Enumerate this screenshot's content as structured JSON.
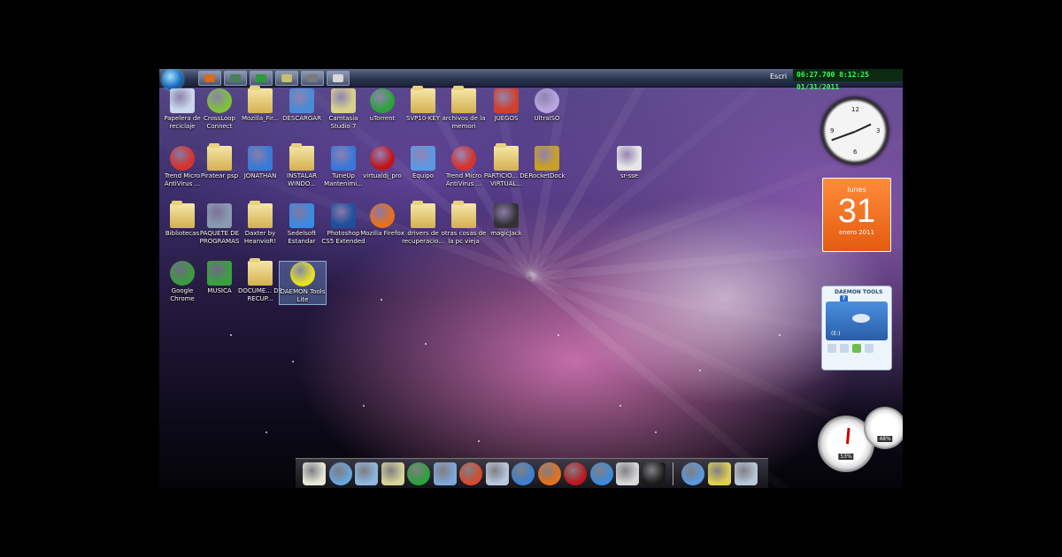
{
  "taskbar": {
    "tray_label": "Escri",
    "clock_text": "06:27.700 8:12:25  01/31/2011",
    "buttons": [
      {
        "name": "media-player",
        "color": "#d86b1c"
      },
      {
        "name": "network",
        "color": "#4a7f5a"
      },
      {
        "name": "utorrent",
        "color": "#2a9a3a"
      },
      {
        "name": "note",
        "color": "#c8c070"
      },
      {
        "name": "tools",
        "color": "#7a7a7a"
      },
      {
        "name": "window",
        "color": "#d8d8d8"
      }
    ]
  },
  "desktop_icons": [
    {
      "label": "Papelera de reciclaje",
      "icon": "recycle-bin-icon",
      "color": "#c9d8ec"
    },
    {
      "label": "CrossLoop Connect",
      "icon": "crossloop-icon",
      "color": "#7fc23a"
    },
    {
      "label": "Mozilla_Fir...",
      "icon": "folder-icon",
      "color": "#e8cf79"
    },
    {
      "label": "DESCARGAR",
      "icon": "computer-icon",
      "color": "#4a8bd6"
    },
    {
      "label": "Camtasia Studio 7",
      "icon": "camtasia-icon",
      "color": "#d7d18a"
    },
    {
      "label": "uTorrent",
      "icon": "utorrent-icon",
      "color": "#2aa33a"
    },
    {
      "label": "SVP10-KEY",
      "icon": "folder-icon",
      "color": "#e8cf79"
    },
    {
      "label": "archivos de la memori",
      "icon": "folder-icon",
      "color": "#e8cf79"
    },
    {
      "label": "JUEGOS",
      "icon": "games-icon",
      "color": "#d0402a"
    },
    {
      "label": "UltraISO",
      "icon": "disc-icon",
      "color": "#b9a6e0"
    },
    {
      "label": "Trend Micro AntiVirus ...",
      "icon": "trend-micro-icon",
      "color": "#d8322a"
    },
    {
      "label": "Piratear psp",
      "icon": "folder-icon",
      "color": "#e8cf79"
    },
    {
      "label": "JONATHAN",
      "icon": "monitor-icon",
      "color": "#3a7ad6"
    },
    {
      "label": "INSTALAR WINDO...",
      "icon": "folder-icon",
      "color": "#e8cf79"
    },
    {
      "label": "TuneUp Mantenimi...",
      "icon": "tuneup-icon",
      "color": "#3a78d8"
    },
    {
      "label": "virtualdj_pro",
      "icon": "virtualdj-icon",
      "color": "#c0141c"
    },
    {
      "label": "Equipo",
      "icon": "computer-icon",
      "color": "#5a9ae0"
    },
    {
      "label": "Trend Micro AntiVirus ...",
      "icon": "trend-micro-icon",
      "color": "#d8322a"
    },
    {
      "label": "PARTICIO... DE VIRTUAL...",
      "icon": "folder-icon",
      "color": "#e8cf79"
    },
    {
      "label": "RocketDock",
      "icon": "rocketdock-icon",
      "color": "#c9a020"
    },
    {
      "label": "Bibliotecas",
      "icon": "libraries-icon",
      "color": "#e8cf79"
    },
    {
      "label": "PAQUETE DE PROGRAMAS",
      "icon": "installer-icon",
      "color": "#8a9ab0"
    },
    {
      "label": "Daxter by HeanvioR!",
      "icon": "folder-icon",
      "color": "#e8cf79"
    },
    {
      "label": "Sedelsoft Estandar",
      "icon": "chat-icon",
      "color": "#3a8be0"
    },
    {
      "label": "Photoshop CS5 Extended",
      "icon": "photoshop-icon",
      "color": "#1f4f9a"
    },
    {
      "label": "Mozilla Firefox",
      "icon": "firefox-icon",
      "color": "#e8701a"
    },
    {
      "label": "drivers de recuperacio...",
      "icon": "folder-icon",
      "color": "#e8cf79"
    },
    {
      "label": "otras cosas de la pc vieja",
      "icon": "folder-icon",
      "color": "#e8cf79"
    },
    {
      "label": "magicJack",
      "icon": "magicjack-icon",
      "color": "#333333"
    },
    {
      "label": "Google Chrome",
      "icon": "chrome-icon",
      "color": "#3b9b3f"
    },
    {
      "label": "MUSICA",
      "icon": "music-arrow-icon",
      "color": "#3aa040"
    },
    {
      "label": "DOCUME... DE RECUP...",
      "icon": "folder-icon",
      "color": "#e8cf79"
    },
    {
      "label": "DAEMON Tools Lite",
      "icon": "daemon-tools-icon",
      "color": "#e8e020"
    },
    {
      "label": "sr-sse",
      "icon": "file-icon",
      "color": "#e6e6e6"
    }
  ],
  "gadgets": {
    "clock": {
      "numbers": [
        "12",
        "3",
        "6",
        "9"
      ]
    },
    "calendar": {
      "weekday": "lunes",
      "day": "31",
      "month_year": "enero 2011"
    },
    "daemon": {
      "title": "DAEMON TOOLS",
      "help": "?",
      "drive": "(E:)"
    },
    "cpu_meter": {
      "value": "53%"
    },
    "ram_meter": {
      "value": "48%"
    }
  },
  "dock": {
    "items": [
      {
        "name": "notes-dock-icon",
        "color": "#e8e8d8"
      },
      {
        "name": "globe-dock-icon",
        "color": "#6aa6de"
      },
      {
        "name": "folder-dock-icon",
        "color": "#8fb7e0"
      },
      {
        "name": "note-dock-icon",
        "color": "#d8d49a"
      },
      {
        "name": "utorrent-dock-icon",
        "color": "#2aa33a"
      },
      {
        "name": "files-dock-icon",
        "color": "#7fa8d8"
      },
      {
        "name": "chrome-dock-icon",
        "color": "#d84a2a"
      },
      {
        "name": "documents-dock-icon",
        "color": "#b8c8dc"
      },
      {
        "name": "ie-dock-icon",
        "color": "#3a80d6"
      },
      {
        "name": "firefox-dock-icon",
        "color": "#e8701a"
      },
      {
        "name": "virtualdj-dock-icon",
        "color": "#c0141c"
      },
      {
        "name": "messenger-dock-icon",
        "color": "#3a8be0"
      },
      {
        "name": "tools-dock-icon",
        "color": "#d8d8d8"
      },
      {
        "name": "shirt-dock-icon",
        "color": "#1a1a1a"
      },
      {
        "name": "network-dock-icon",
        "color": "#5a9ae0"
      },
      {
        "name": "ftp-dock-icon",
        "color": "#e0d050"
      },
      {
        "name": "trash-dock-icon",
        "color": "#b8c8d8"
      }
    ]
  }
}
